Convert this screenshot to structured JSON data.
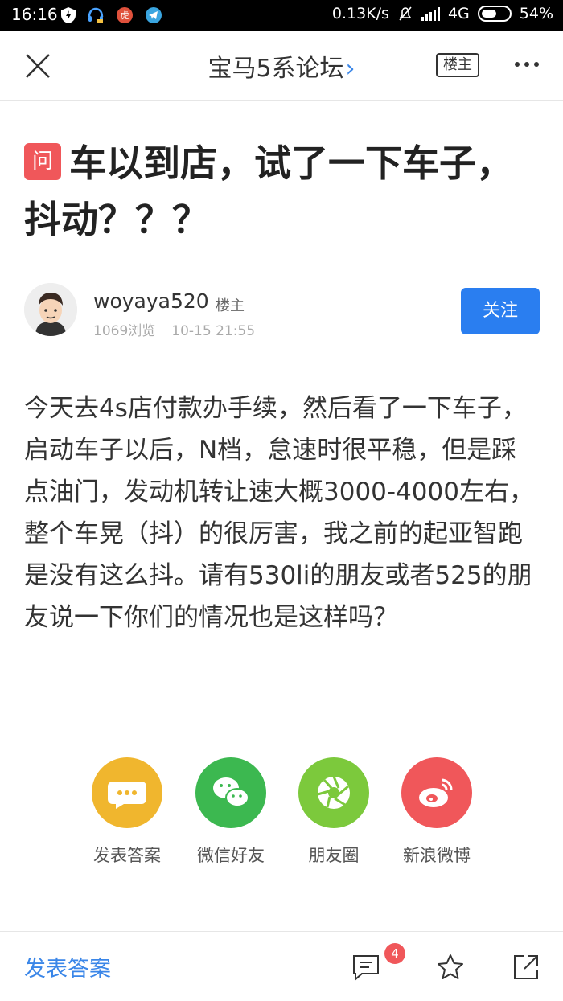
{
  "status_bar": {
    "time": "16:16",
    "network_speed": "0.13K/s",
    "network_type": "4G",
    "battery_percent": "54%"
  },
  "nav": {
    "title": "宝马5系论坛",
    "chevron": "›",
    "louzhu_label": "楼主"
  },
  "post": {
    "badge": "问",
    "title": "车以到店，试了一下车子，抖动？？？",
    "author": {
      "name": "woyaya520",
      "tag": "楼主",
      "views": "1069浏览",
      "time": "10-15 21:55"
    },
    "follow_label": "关注",
    "body": "今天去4s店付款办手续，然后看了一下车子，启动车子以后，N档，怠速时很平稳，但是踩点油门，发动机转让速大概3000-4000左右，整个车晃（抖）的很厉害，我之前的起亚智跑是没有这么抖。请有530li的朋友或者525的朋友说一下你们的情况也是这样吗？"
  },
  "share": [
    {
      "label": "发表答案",
      "color": "#f0b62e",
      "icon": "chat-bubble-icon"
    },
    {
      "label": "微信好友",
      "color": "#3cb850",
      "icon": "wechat-icon"
    },
    {
      "label": "朋友圈",
      "color": "#7cc93c",
      "icon": "moments-icon"
    },
    {
      "label": "新浪微博",
      "color": "#f0575a",
      "icon": "weibo-icon"
    }
  ],
  "bottom_bar": {
    "answer_label": "发表答案",
    "comment_count": "4"
  }
}
